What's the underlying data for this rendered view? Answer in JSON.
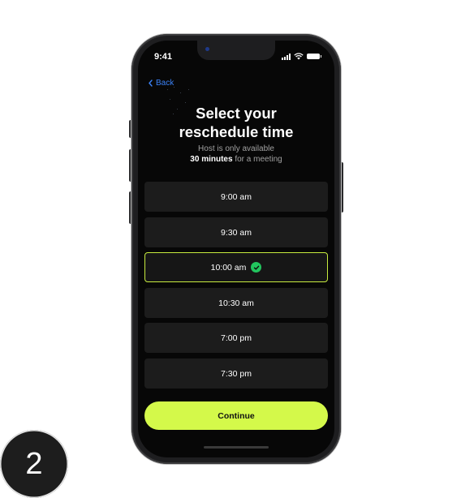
{
  "status_bar": {
    "time": "9:41"
  },
  "nav": {
    "back_label": "Back"
  },
  "header": {
    "title_line1": "Select your",
    "title_line2": "reschedule time",
    "subtitle_line1": "Host is only available",
    "subtitle_bold": "30 minutes",
    "subtitle_rest": " for a meeting"
  },
  "slots": [
    {
      "label": "9:00 am",
      "selected": false
    },
    {
      "label": "9:30 am",
      "selected": false
    },
    {
      "label": "10:00 am",
      "selected": true
    },
    {
      "label": "10:30 am",
      "selected": false
    },
    {
      "label": "7:00 pm",
      "selected": false
    },
    {
      "label": "7:30 pm",
      "selected": false
    }
  ],
  "continue_label": "Continue",
  "step_number": "2",
  "colors": {
    "accent": "#d4f94a",
    "selected_border": "#c8ec3f",
    "check": "#22c55e",
    "link": "#3b82f6",
    "screen_bg": "#070707",
    "slot_bg": "#1c1c1c"
  },
  "icons": {
    "back": "chevron-left-icon",
    "check": "check-circle-icon",
    "signal": "signal-icon",
    "wifi": "wifi-icon",
    "battery": "battery-icon"
  }
}
